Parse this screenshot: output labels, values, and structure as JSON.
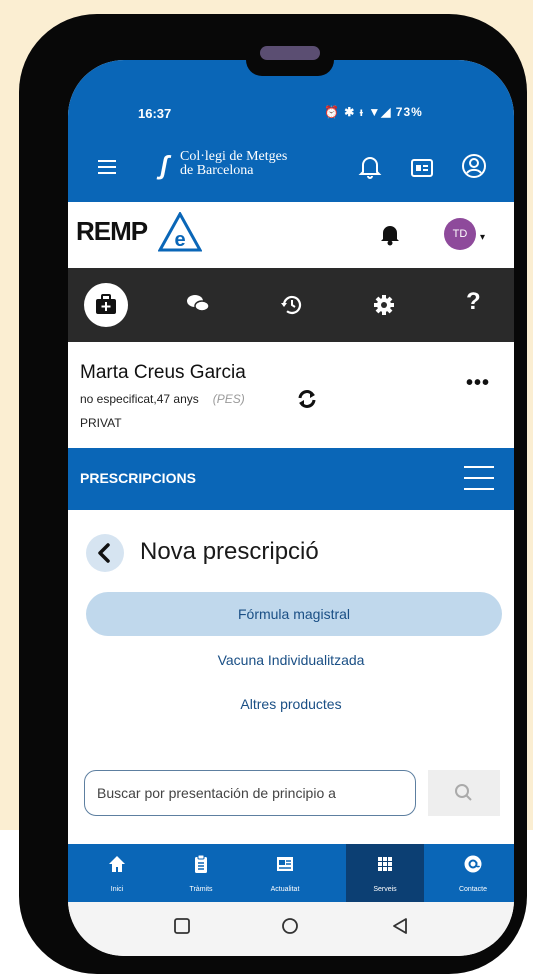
{
  "status_bar": {
    "time": "16:37",
    "icons_text": "⏰ ✱ ᵻ ▼◢ 73%",
    "battery_percent": "73%"
  },
  "app_header": {
    "logo_line1": "Col·legi de Metges",
    "logo_line2": "de Barcelona",
    "color": "#0a66b7"
  },
  "rempe": {
    "logo_text": "REMP",
    "logo_e": "e",
    "avatar_initials": "TD",
    "avatar_color": "#8e4a9b"
  },
  "toolbar": {
    "items": [
      "medical-kit-icon",
      "chat-icon",
      "history-icon",
      "settings-icon",
      "help-icon"
    ],
    "help_label": "?"
  },
  "patient": {
    "name": "Marta Creus Garcia",
    "details": "no especificat,47 anys",
    "weight": "(PES)",
    "plan": "PRIVAT",
    "more": "•••"
  },
  "section": {
    "title": "PRESCRIPCIONS"
  },
  "prescription": {
    "title": "Nova prescripció",
    "options": [
      "Fórmula magistral",
      "Vacuna Individualitzada",
      "Altres productes"
    ],
    "selected_index": 0
  },
  "search": {
    "placeholder": "Buscar por presentación de principio a"
  },
  "bottom_nav": {
    "items": [
      {
        "label": "Inici",
        "icon": "home-icon"
      },
      {
        "label": "Tràmits",
        "icon": "clipboard-icon"
      },
      {
        "label": "Actualitat",
        "icon": "news-icon"
      },
      {
        "label": "Serveis",
        "icon": "grid-icon"
      },
      {
        "label": "Contacte",
        "icon": "at-icon"
      }
    ],
    "active_index": 3
  }
}
